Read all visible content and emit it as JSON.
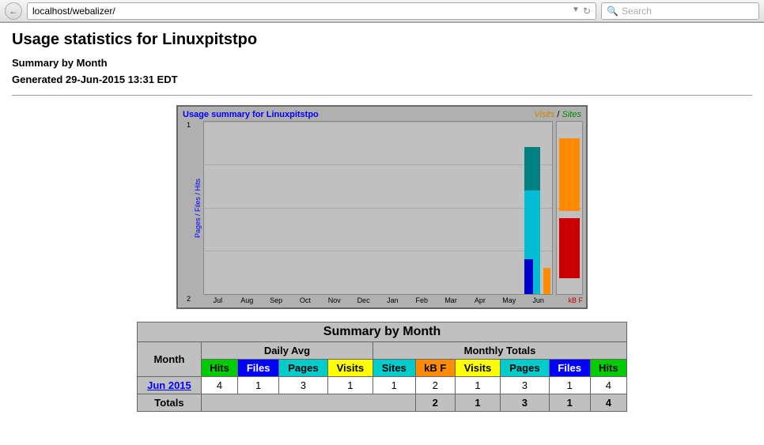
{
  "browser": {
    "address": "localhost/webalizer/",
    "search_placeholder": "Search"
  },
  "page": {
    "title": "Usage statistics for Linuxpitstpo",
    "summary_label": "Summary by Month",
    "generated": "Generated 29-Jun-2015 13:31 EDT"
  },
  "chart": {
    "title": "Usage summary for Linuxpitstpo",
    "legend_visits": "Visits",
    "legend_sep": " / ",
    "legend_sites": "Sites",
    "y_label": "Pages / Files / Hits",
    "x_labels": [
      "Jul",
      "Aug",
      "Sep",
      "Oct",
      "Nov",
      "Dec",
      "Jan",
      "Feb",
      "Mar",
      "Apr",
      "May",
      "Jun"
    ],
    "kb_label": "kB F",
    "tick_top": "1",
    "tick_bottom": "2"
  },
  "table": {
    "title": "Summary by Month",
    "col_groups": {
      "daily_avg": "Daily Avg",
      "monthly_totals": "Monthly Totals"
    },
    "col_headers": {
      "month": "Month",
      "hits": "Hits",
      "files": "Files",
      "pages": "Pages",
      "visits": "Visits",
      "sites": "Sites",
      "kbf": "kB F",
      "visits2": "Visits",
      "pages2": "Pages",
      "files2": "Files",
      "hits2": "Hits"
    },
    "rows": [
      {
        "month": "Jun 2015",
        "month_link": "#",
        "daily_hits": "4",
        "daily_files": "1",
        "daily_pages": "3",
        "daily_visits": "1",
        "sites": "1",
        "kbf": "2",
        "visits": "1",
        "pages": "3",
        "files": "1",
        "hits": "4"
      }
    ],
    "totals": {
      "label": "Totals",
      "kbf": "2",
      "visits": "1",
      "pages": "3",
      "files": "1",
      "hits": "4"
    }
  }
}
